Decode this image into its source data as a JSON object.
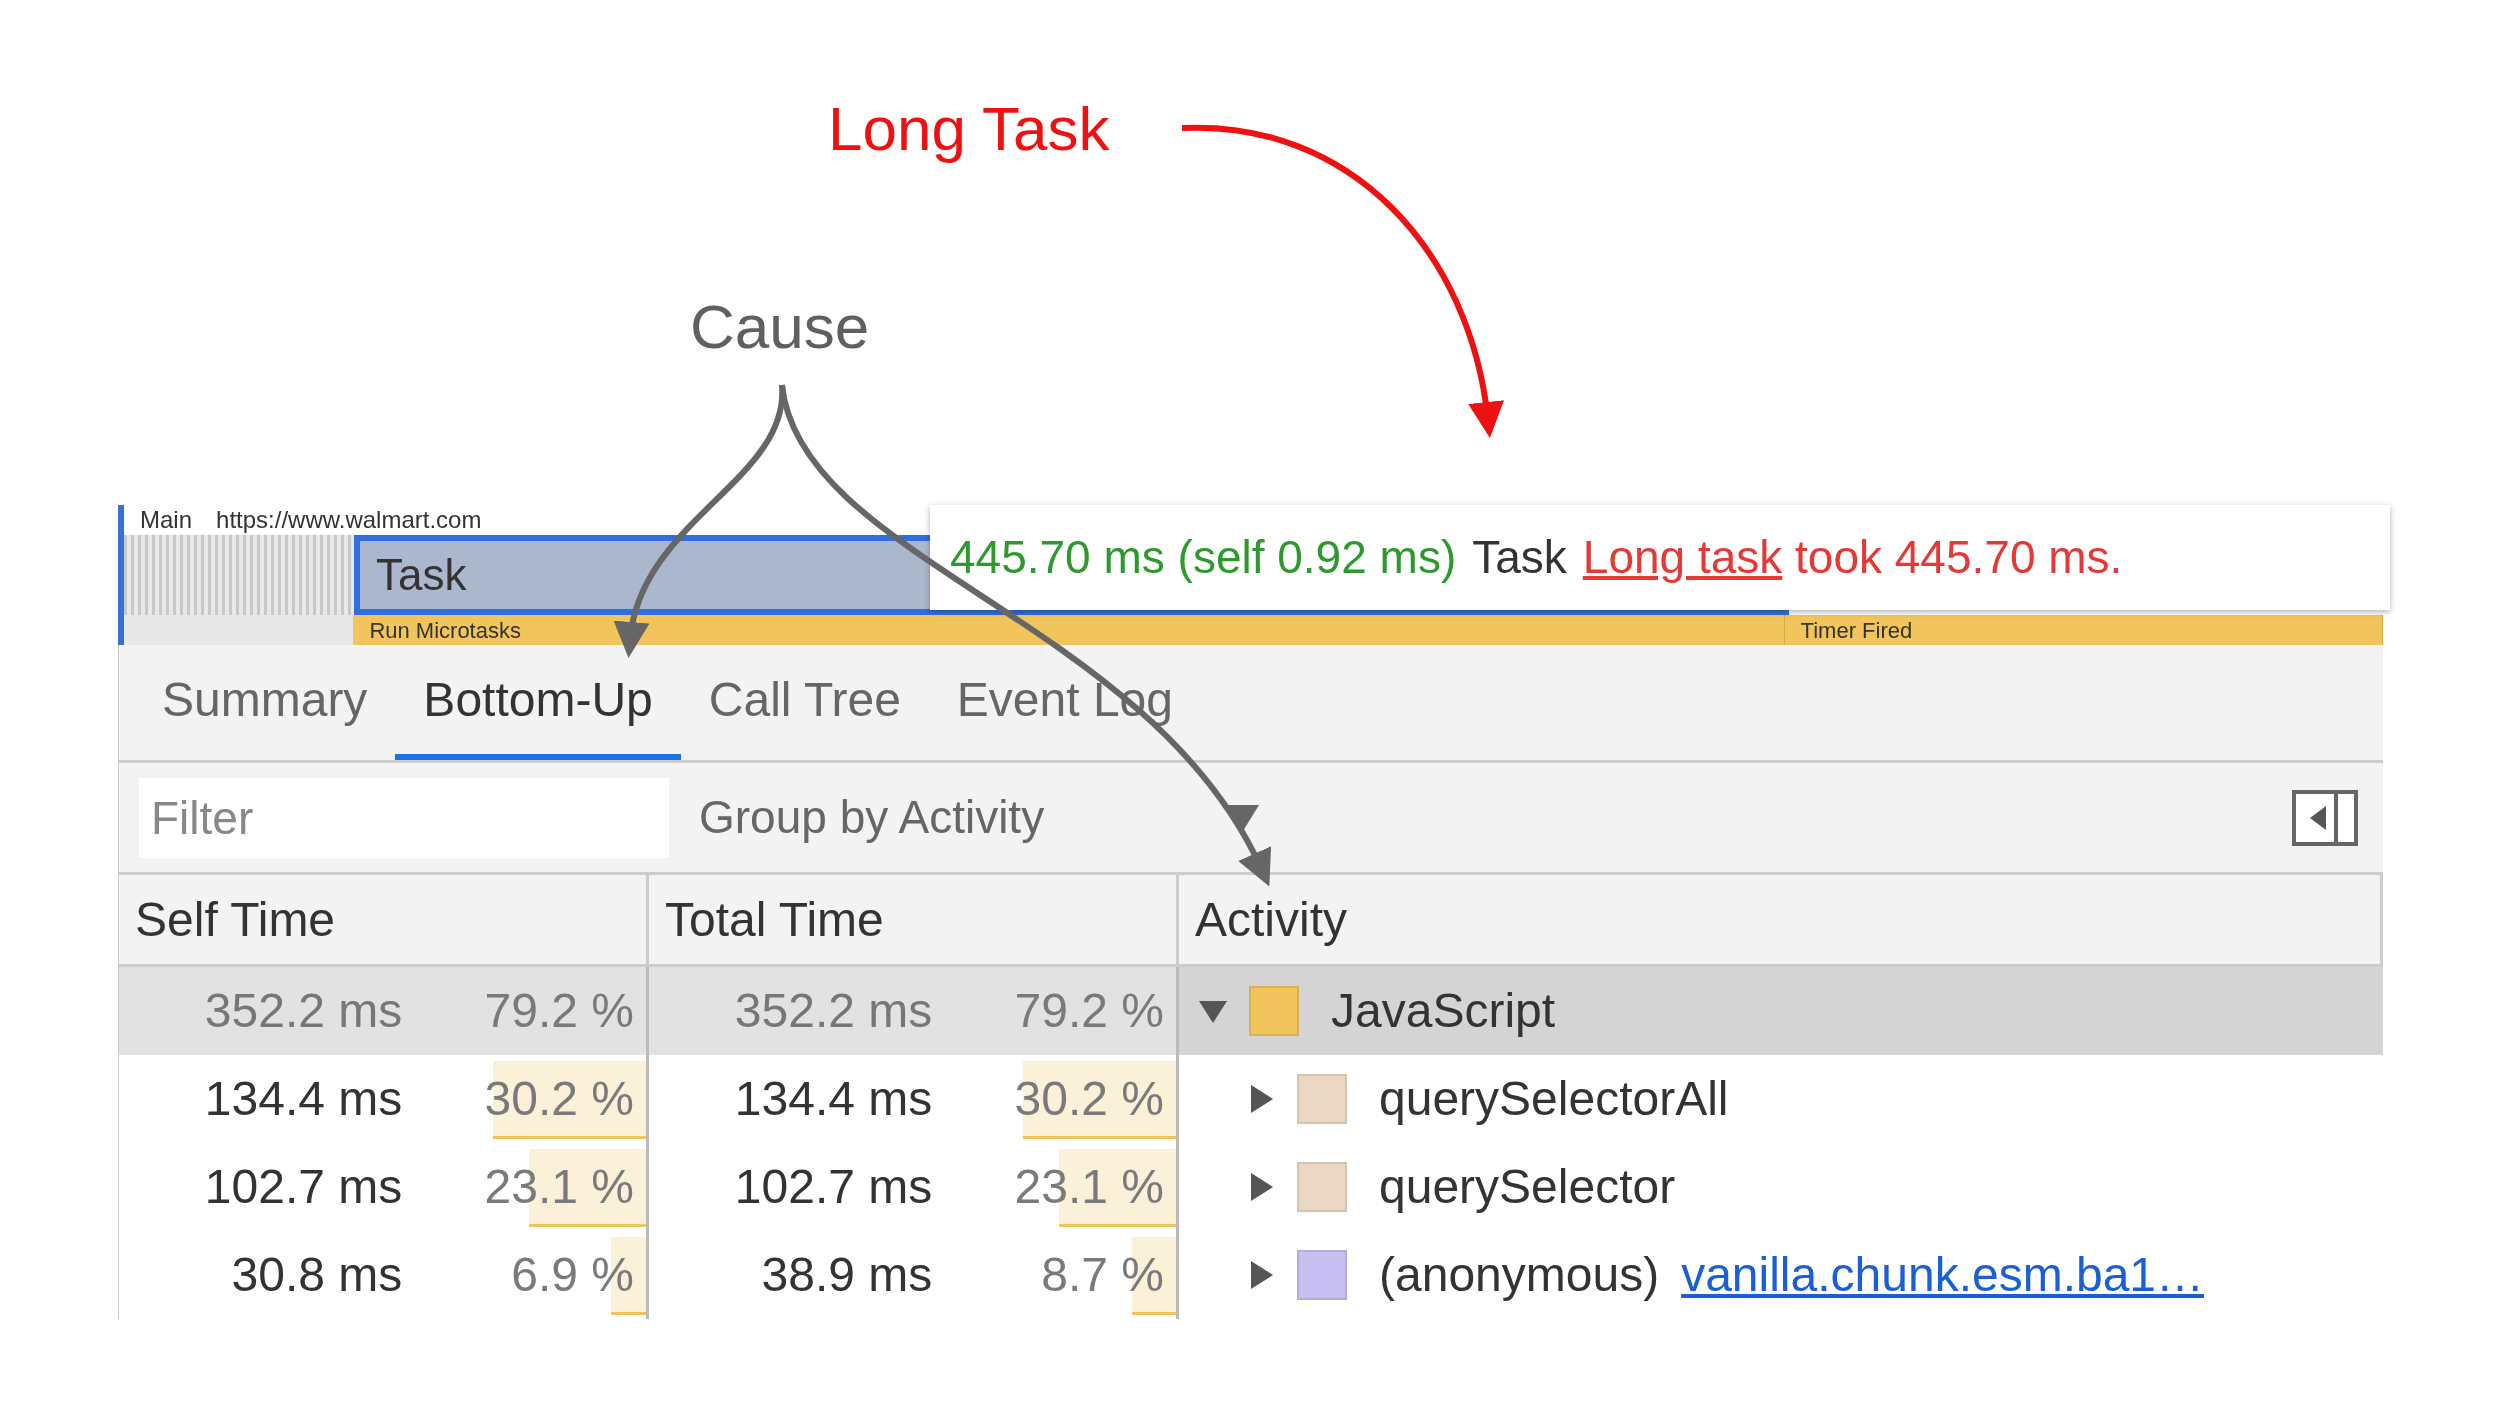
{
  "annotations": [
    {
      "kind": "long_task",
      "text": "Long Task"
    },
    {
      "kind": "cause",
      "text": "Cause"
    }
  ],
  "flame": {
    "track_label": "Main",
    "url": "https://www.walmart.com",
    "task": "Task",
    "children": [
      "Run Microtasks",
      "Timer Fired"
    ]
  },
  "tooltip": {
    "duration": "445.70 ms (self 0.92 ms)",
    "name": "Task",
    "warning_link": "Long task",
    "warning_text": "took 445.70 ms."
  },
  "tabs": [
    {
      "label": "Summary",
      "selected": false
    },
    {
      "label": "Bottom-Up",
      "selected": true
    },
    {
      "label": "Call Tree",
      "selected": false
    },
    {
      "label": "Event Log",
      "selected": false
    }
  ],
  "filter": {
    "placeholder": "Filter"
  },
  "group_by": "Group by Activity",
  "columns": [
    "Self Time",
    "Total Time",
    "Activity"
  ],
  "rows": [
    {
      "self_time": "352.2 ms",
      "self_pct": "79.2 %",
      "total_time": "352.2 ms",
      "total_pct": "79.2 %",
      "activity": "JavaScript",
      "color": "#f2c55c",
      "expanded": true,
      "selected": true
    },
    {
      "self_time": "134.4 ms",
      "self_pct": "30.2 %",
      "self_bar": {
        "level": 0.302
      },
      "total_time": "134.4 ms",
      "total_pct": "30.2 %",
      "total_bar": {
        "level": 0.302
      },
      "activity": "querySelectorAll",
      "color": "#ead8c4",
      "expanded": false,
      "selected": false
    },
    {
      "self_time": "102.7 ms",
      "self_pct": "23.1 %",
      "self_bar": {
        "level": 0.231
      },
      "total_time": "102.7 ms",
      "total_pct": "23.1 %",
      "total_bar": {
        "level": 0.231
      },
      "activity": "querySelector",
      "color": "#ead8c4",
      "expanded": false,
      "selected": false
    },
    {
      "self_time": "30.8 ms",
      "self_pct": "6.9 %",
      "self_bar": {
        "level": 0.069
      },
      "total_time": "38.9 ms",
      "total_pct": "8.7 %",
      "total_bar": {
        "level": 0.087
      },
      "activity": "(anonymous)",
      "link": "vanilla.chunk.esm.ba1…",
      "color": "#c8c0f0",
      "expanded": false,
      "selected": false
    }
  ]
}
